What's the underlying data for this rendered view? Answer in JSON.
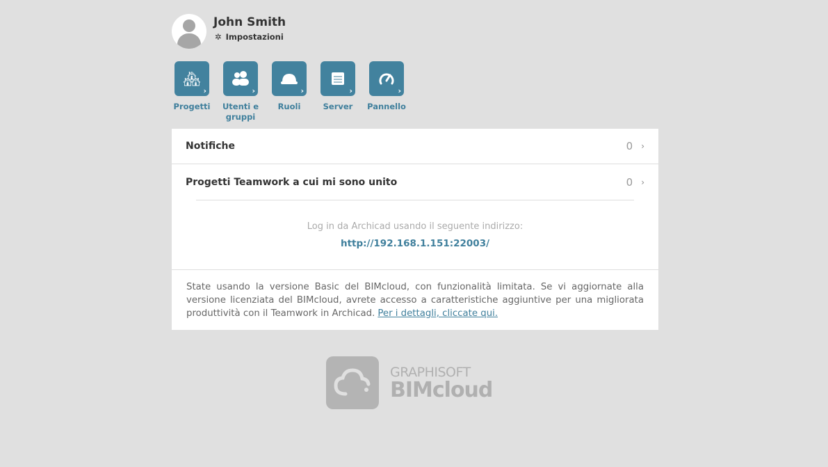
{
  "user": {
    "name": "John Smith",
    "settings_label": "Impostazioni"
  },
  "tiles": [
    {
      "label": "Progetti",
      "icon": "buildings-icon"
    },
    {
      "label": "Utenti e gruppi",
      "icon": "users-icon"
    },
    {
      "label": "Ruoli",
      "icon": "hardhat-icon"
    },
    {
      "label": "Server",
      "icon": "server-icon"
    },
    {
      "label": "Pannello",
      "icon": "gauge-icon"
    }
  ],
  "rows": [
    {
      "label": "Notifiche",
      "count": "0"
    },
    {
      "label": "Progetti Teamwork a cui mi sono unito",
      "count": "0"
    }
  ],
  "login": {
    "text": "Log in da Archicad usando il seguente indirizzo:",
    "url": "http://192.168.1.151:22003/"
  },
  "basic": {
    "text": "State usando la versione Basic del BIMcloud, con funzionalità limitata. Se vi aggiornate alla versione licenziata del BIMcloud, avrete accesso a caratteristiche aggiuntive per una migliorata produttività con il Teamwork in Archicad.",
    "link": "Per i dettagli, cliccate qui."
  },
  "logo": {
    "brand": "GRAPHISOFT",
    "product": "BIMcloud"
  },
  "colors": {
    "accent": "#42829e",
    "background": "#e0e0e0"
  }
}
